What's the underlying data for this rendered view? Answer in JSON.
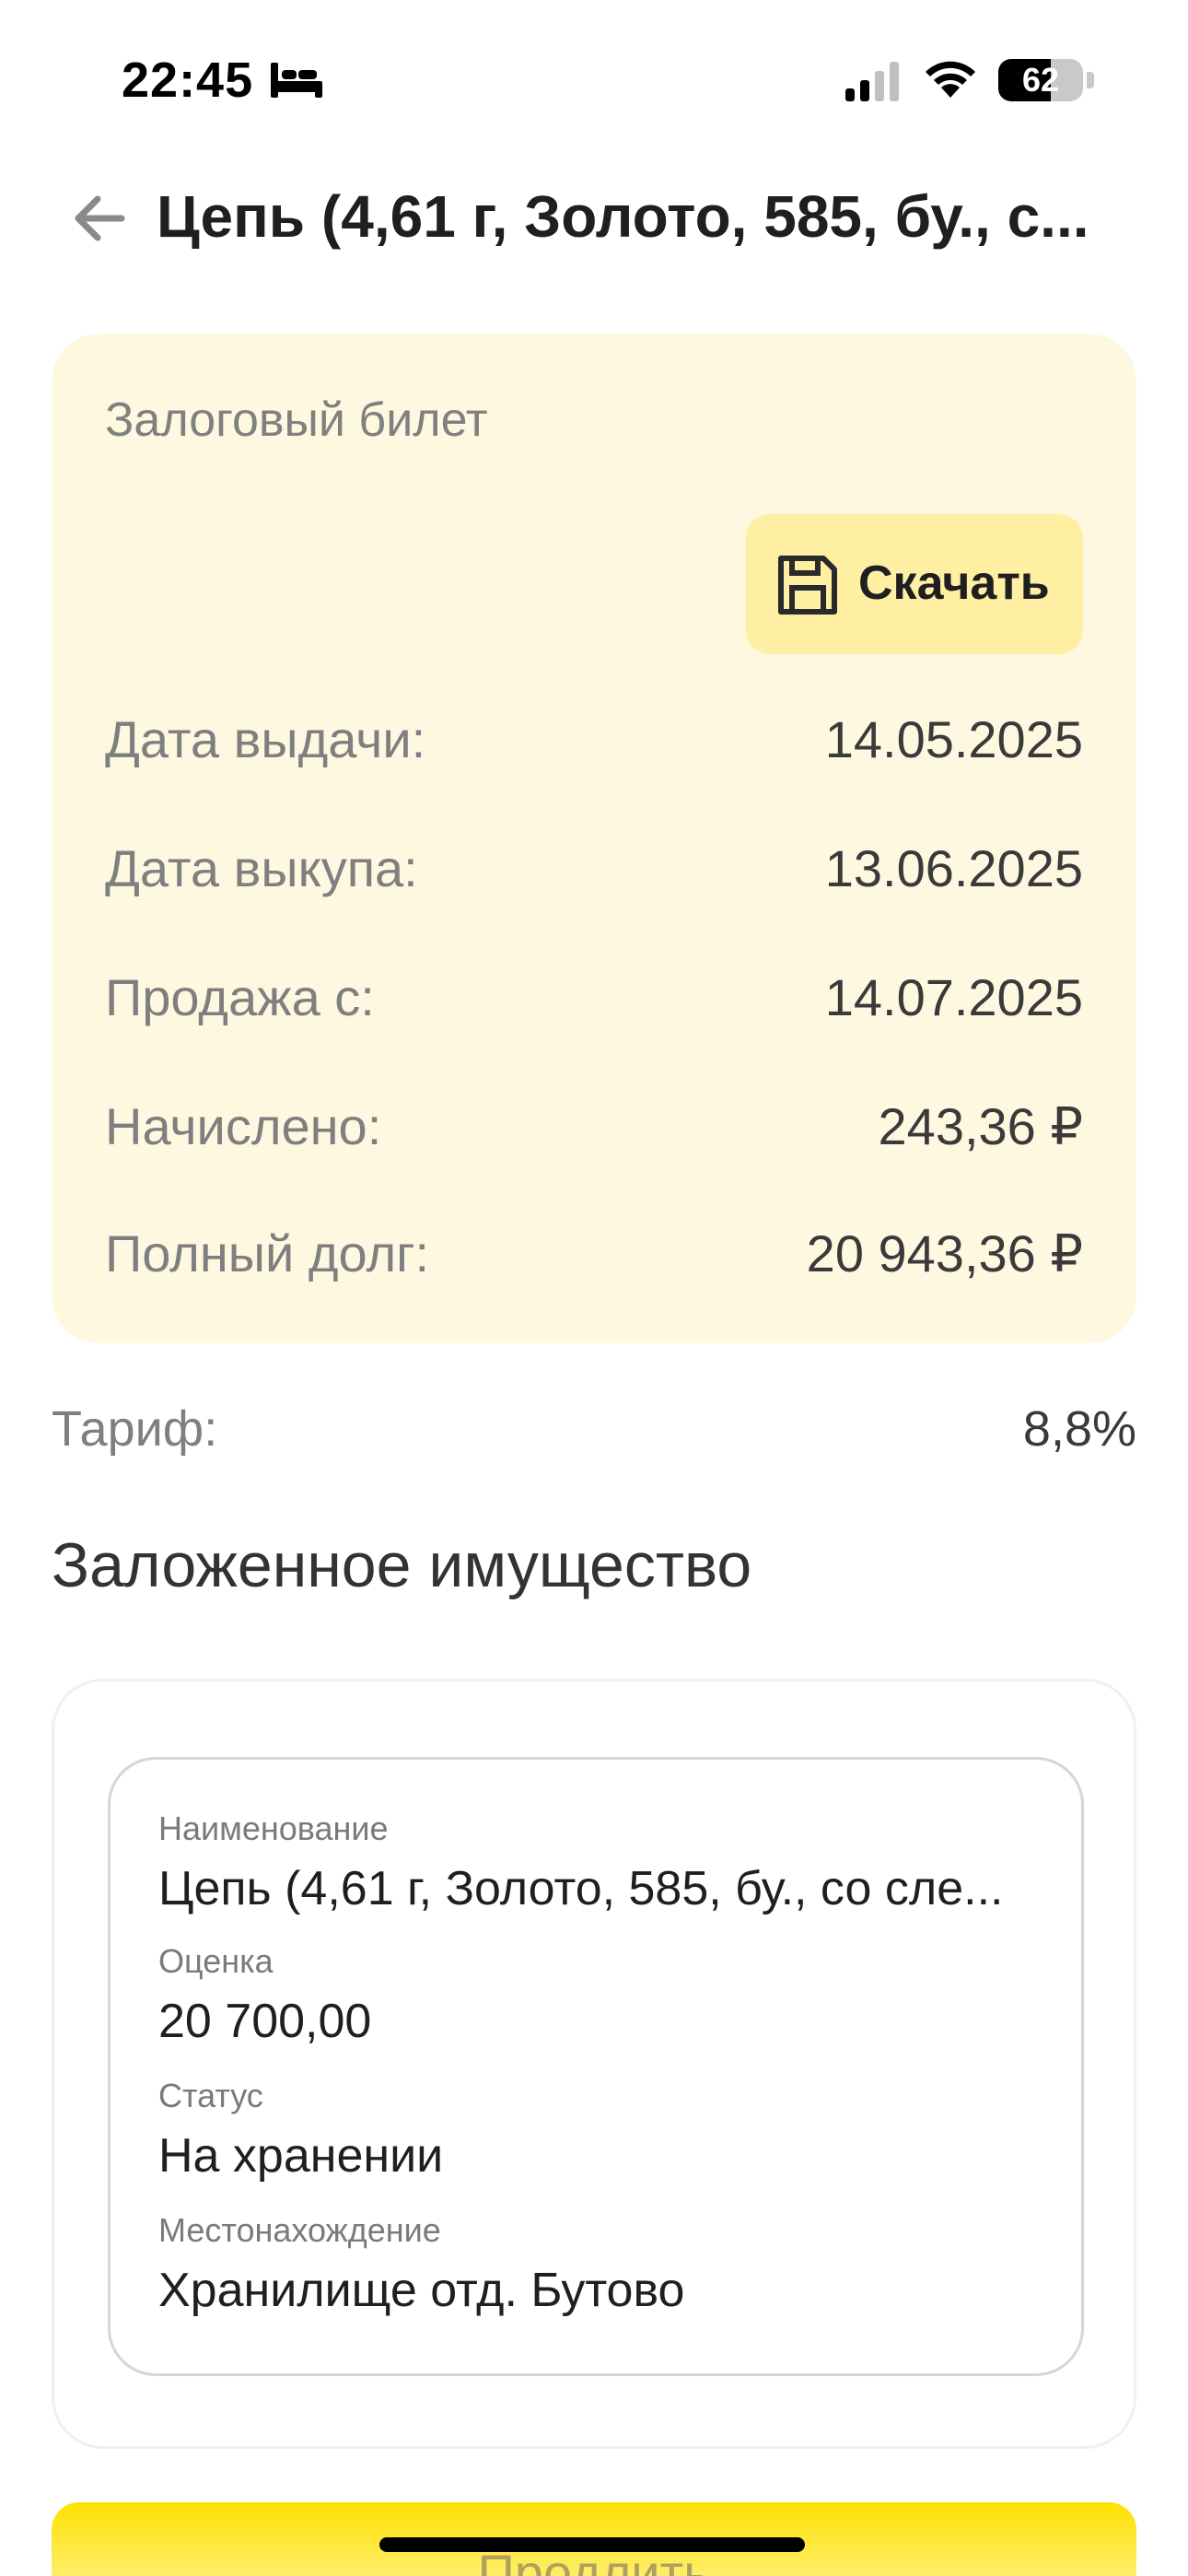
{
  "status_bar": {
    "time": "22:45",
    "battery_level": "62",
    "battery_percent": 62
  },
  "header": {
    "title": "Цепь (4,61 г, Золото, 585, бу., с..."
  },
  "ticket": {
    "title": "Залоговый билет",
    "download_label": "Скачать",
    "rows": [
      {
        "label": "Дата выдачи:",
        "value": "14.05.2025"
      },
      {
        "label": "Дата выкупа:",
        "value": "13.06.2025"
      },
      {
        "label": "Продажа с:",
        "value": "14.07.2025"
      },
      {
        "label": "Начислено:",
        "value": "243,36 ₽"
      },
      {
        "label": "Полный долг:",
        "value": "20 943,36 ₽"
      }
    ]
  },
  "tariff": {
    "label": "Тариф:",
    "value": "8,8%"
  },
  "property": {
    "section_title": "Заложенное имущество",
    "fields": [
      {
        "label": "Наименование",
        "value": "Цепь (4,61 г, Золото, 585, бу., со сле..."
      },
      {
        "label": "Оценка",
        "value": "20 700,00"
      },
      {
        "label": "Статус",
        "value": "На хранении"
      },
      {
        "label": "Местонахождение",
        "value": "Хранилище отд. Бутово"
      }
    ]
  },
  "footer": {
    "extend_label": "Продлить"
  },
  "colors": {
    "ticket_bg": "#fff8e1",
    "download_bg": "#ffefa3",
    "accent": "#ffe100"
  }
}
